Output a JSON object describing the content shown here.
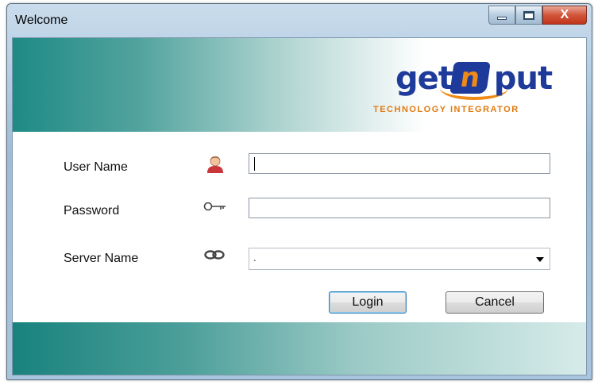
{
  "window": {
    "title": "Welcome",
    "controls": {
      "minimize_icon": "minimize-icon",
      "maximize_icon": "maximize-icon",
      "close_icon": "close-icon",
      "close_glyph": "X"
    }
  },
  "banner": {
    "logo": {
      "word_left": "get",
      "badge_letter": "n",
      "word_right": "put",
      "tagline": "Technology Integrator",
      "colors": {
        "primary": "#1e3a9a",
        "accent": "#f08a16"
      }
    },
    "gradient_colors": [
      "#1f8a85",
      "#ffffff"
    ]
  },
  "form": {
    "username": {
      "label": "User Name",
      "icon": "user-icon",
      "value": "",
      "placeholder": ""
    },
    "password": {
      "label": "Password",
      "icon": "key-icon",
      "value": "",
      "placeholder": ""
    },
    "server": {
      "label": "Server Name",
      "icon": "link-icon",
      "selected": "."
    }
  },
  "buttons": {
    "login": "Login",
    "cancel": "Cancel"
  }
}
